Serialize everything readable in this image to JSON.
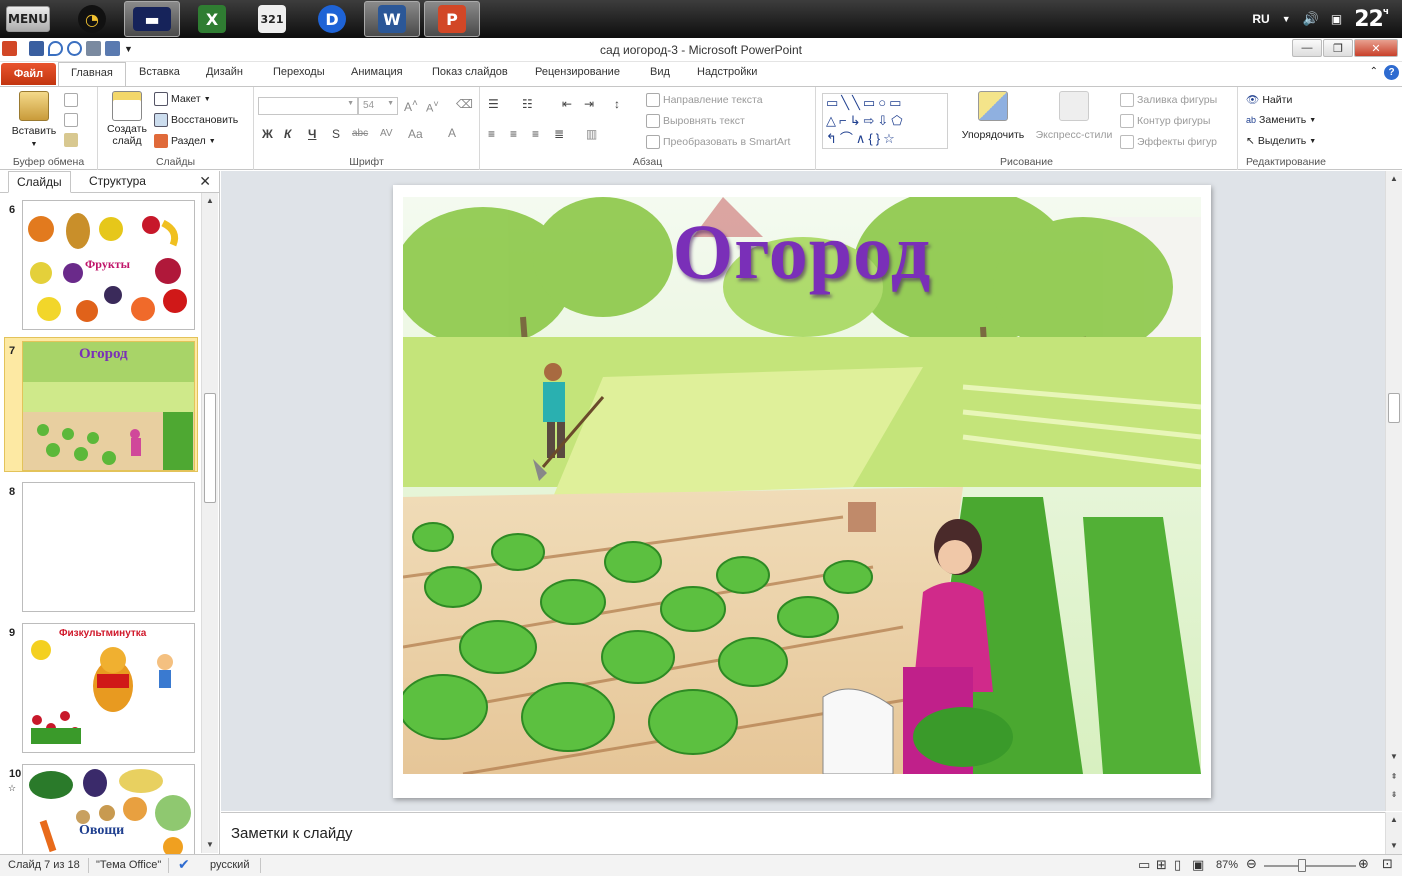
{
  "taskbar": {
    "menu_label": "MENU",
    "language": "RU",
    "clock": "22",
    "clock_suffix": "ч",
    "apps": [
      {
        "icon": "disc-icon",
        "color": "#222",
        "glyph": "◔"
      },
      {
        "icon": "monitor-icon",
        "color": "#1a2a60",
        "glyph": "▬"
      },
      {
        "icon": "excel-icon",
        "color": "#2f7d32",
        "glyph": "X"
      },
      {
        "icon": "countdown-icon",
        "color": "#333",
        "glyph": "321"
      },
      {
        "icon": "player-icon",
        "color": "#1e63d6",
        "glyph": "D"
      },
      {
        "icon": "word-icon",
        "color": "#2b5797",
        "glyph": "W"
      },
      {
        "icon": "powerpoint-icon",
        "color": "#d24726",
        "glyph": "P"
      }
    ]
  },
  "window": {
    "title": "сад иогород-3  -  Microsoft PowerPoint",
    "minimize": "—",
    "restore": "❐",
    "close": "✕"
  },
  "ribbon_tabs": {
    "file": "Файл",
    "home": "Главная",
    "insert": "Вставка",
    "design": "Дизайн",
    "transitions": "Переходы",
    "animation": "Анимация",
    "slideshow": "Показ слайдов",
    "review": "Рецензирование",
    "view": "Вид",
    "addins": "Надстройки"
  },
  "ribbon": {
    "clipboard": {
      "paste": "Вставить",
      "label": "Буфер обмена"
    },
    "slides": {
      "new_slide": "Создать слайд",
      "layout": "Макет",
      "reset": "Восстановить",
      "section": "Раздел",
      "label": "Слайды"
    },
    "font": {
      "size": "54",
      "bold": "Ж",
      "italic": "К",
      "underline": "Ч",
      "shadow": "S",
      "strike": "abc",
      "spacing": "AV",
      "case": "Aa",
      "color": "A",
      "label": "Шрифт"
    },
    "paragraph": {
      "text_direction": "Направление текста",
      "align_text": "Выровнять текст",
      "smartart": "Преобразовать в SmartArt",
      "label": "Абзац"
    },
    "drawing": {
      "arrange": "Упорядочить",
      "quick_styles": "Экспресс-стили",
      "fill": "Заливка фигуры",
      "outline": "Контур фигуры",
      "effects": "Эффекты фигур",
      "label": "Рисование"
    },
    "editing": {
      "find": "Найти",
      "replace": "Заменить",
      "select": "Выделить",
      "label": "Редактирование"
    }
  },
  "left_pane": {
    "tab_slides": "Слайды",
    "tab_outline": "Структура",
    "close": "✕",
    "thumbnails": [
      {
        "number": "6",
        "label": "Фрукты"
      },
      {
        "number": "7",
        "label": "Огород"
      },
      {
        "number": "8",
        "label": ""
      },
      {
        "number": "9",
        "label": "Физкультминутка"
      },
      {
        "number": "10",
        "label": "Овощи"
      }
    ]
  },
  "slide": {
    "title": "Огород"
  },
  "notes": {
    "placeholder": "Заметки к слайду"
  },
  "statusbar": {
    "slide_info": "Слайд 7 из 18",
    "theme": "\"Тема Office\"",
    "language": "русский",
    "zoom": "87%"
  },
  "colors": {
    "accent": "#c2350f",
    "title": "#7a2fb8",
    "selection": "#fde9a3"
  }
}
